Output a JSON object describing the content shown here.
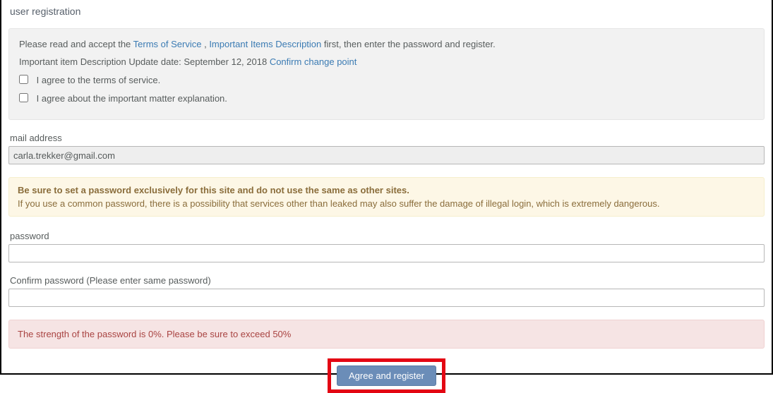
{
  "title": "user registration",
  "info": {
    "prefix": "Please read and accept the ",
    "tos_link": "Terms of Service",
    "comma": " , ",
    "items_link": "Important Items Description",
    "suffix": " first, then enter the password and register.",
    "update_prefix": "Important item Description Update date: September 12, 2018 ",
    "confirm_link": "Confirm change point",
    "agree_tos": "I agree to the terms of service.",
    "agree_matter": "I agree about the important matter explanation."
  },
  "mail": {
    "label": "mail address",
    "value": "carla.trekker@gmail.com"
  },
  "warn": {
    "title": "Be sure to set a password exclusively for this site and do not use the same as other sites.",
    "text": "If you use a common password, there is a possibility that services other than leaked may also suffer the damage of illegal login, which is extremely dangerous."
  },
  "password": {
    "label": "password",
    "value": ""
  },
  "confirm": {
    "label": "Confirm password (Please enter same password)",
    "value": ""
  },
  "strength": "The strength of the password is 0%. Please be sure to exceed 50%",
  "submit": "Agree and register"
}
